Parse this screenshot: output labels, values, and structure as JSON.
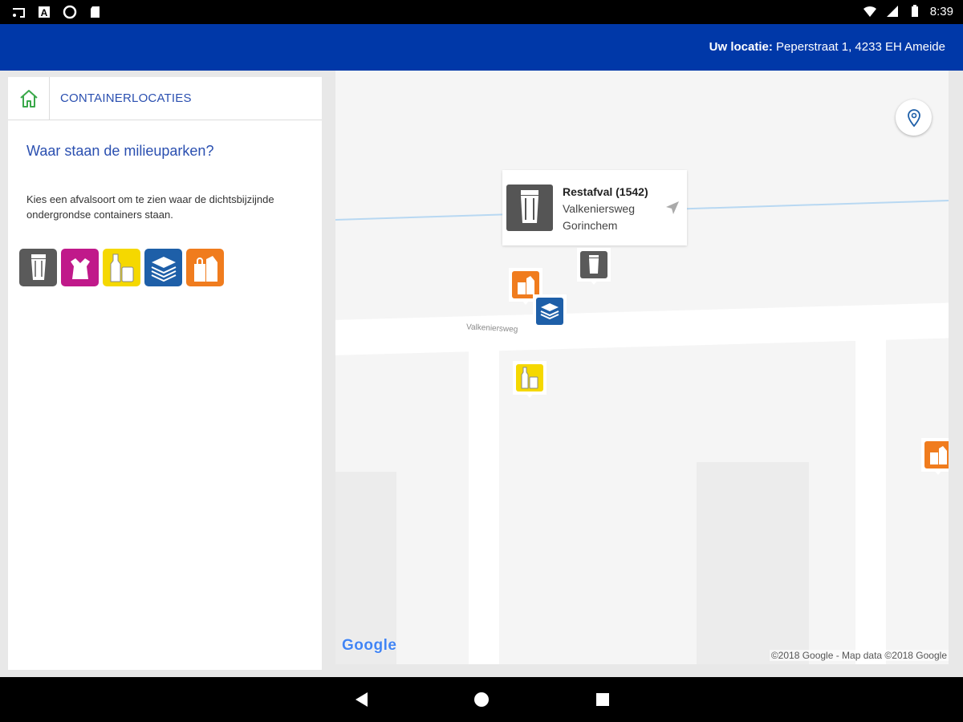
{
  "status_bar": {
    "time": "8:39",
    "left_icons": [
      "cast-icon",
      "a-icon",
      "circle-icon",
      "sd-card-icon"
    ],
    "right_icons": [
      "wifi-icon",
      "signal-icon",
      "battery-icon"
    ]
  },
  "header": {
    "location_label": "Uw locatie:",
    "location_value": "Peperstraat 1, 4233 EH Ameide",
    "background": "#0038a8"
  },
  "panel": {
    "home_icon": "home-icon",
    "title": "CONTAINERLOCATIES",
    "question": "Waar staan de milieuparken?",
    "description": "Kies een afvalsoort om te zien waar de dichtsbijzijnde ondergrondse containers staan.",
    "waste_types": [
      {
        "icon": "restafval-bin-icon",
        "color": "#5a5a5a"
      },
      {
        "icon": "plastic-bag-icon",
        "color": "#c0198a"
      },
      {
        "icon": "glass-bottles-icon",
        "color": "#f5d800"
      },
      {
        "icon": "paper-stack-icon",
        "color": "#1e5fa8"
      },
      {
        "icon": "textile-bags-icon",
        "color": "#f07c1e"
      }
    ]
  },
  "map": {
    "street_label": "Valkeniersweg",
    "popup": {
      "title": "Restafval (1542)",
      "street": "Valkeniersweg",
      "city": "Gorinchem"
    },
    "google_logo": "Google",
    "attribution": "©2018 Google - Map data ©2018 Google",
    "location_button_icon": "location-pin-icon"
  },
  "nav_bar": {
    "icons": [
      "back-icon",
      "home-circle-icon",
      "recents-icon"
    ]
  }
}
